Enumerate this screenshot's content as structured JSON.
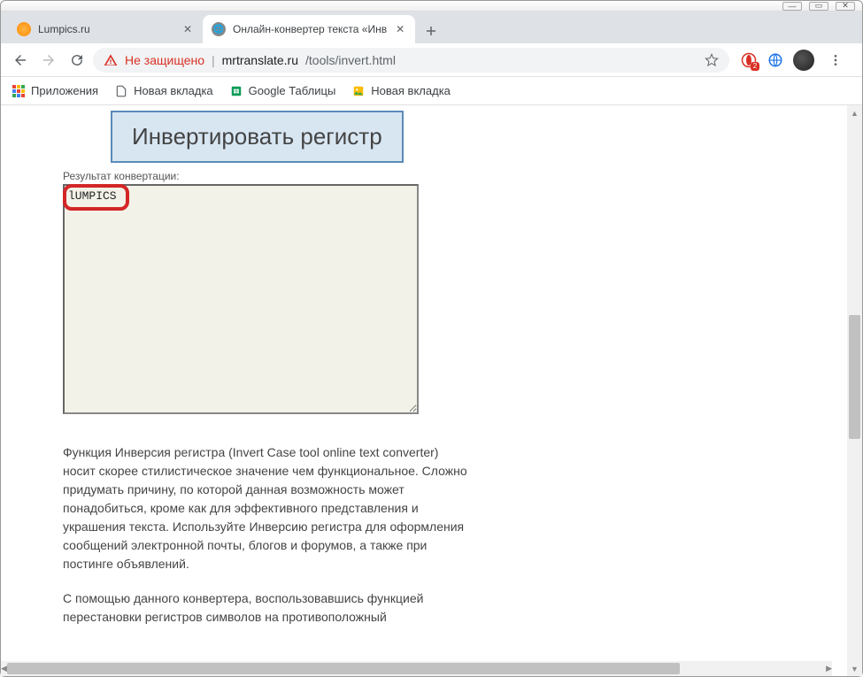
{
  "window_controls": {
    "min": "—",
    "max": "▭",
    "close": "✕"
  },
  "tabs": [
    {
      "title": "Lumpics.ru",
      "active": false
    },
    {
      "title": "Онлайн-конвертер текста «Инв",
      "active": true
    }
  ],
  "toolbar": {
    "not_secure": "Не защищено",
    "url_host": "mrtranslate.ru",
    "url_path": "/tools/invert.html"
  },
  "bookmarks": {
    "apps": "Приложения",
    "newtab1": "Новая вкладка",
    "sheets": "Google Таблицы",
    "newtab2": "Новая вкладка"
  },
  "page": {
    "invert_button": "Инвертировать регистр",
    "result_label": "Результат конвертации:",
    "result_value": "lUMPICS",
    "desc_p1": "Функция Инверсия регистра (Invert Case tool online text converter) носит скорее стилистическое значение чем функциональное. Сложно придумать причину, по которой данная возможность может понадобиться, кроме как для эффективного представления и украшения текста. Используйте Инверсию регистра для оформления сообщений электронной почты, блогов и форумов, а также при постинге объявлений.",
    "desc_p2": "С помощью данного конвертера, воспользовавшись функцией перестановки регистров символов на противоположный"
  },
  "ext_badge": "2"
}
